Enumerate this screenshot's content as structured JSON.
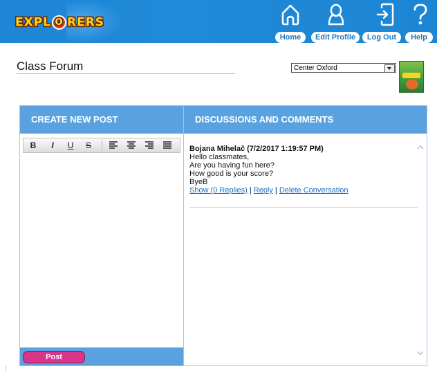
{
  "header": {
    "logo_letters": [
      "EXPL",
      "O",
      "RERS"
    ],
    "nav": [
      {
        "label": "Home",
        "icon": "home-icon"
      },
      {
        "label": "Edit Profile",
        "icon": "user-icon"
      },
      {
        "label": "Log Out",
        "icon": "logout-icon"
      },
      {
        "label": "Help",
        "icon": "help-icon"
      }
    ]
  },
  "page": {
    "title": "Class Forum",
    "class_select": {
      "selected": "Center Oxford"
    },
    "book_cover_icon": "book-cover-icon"
  },
  "create_post": {
    "heading": "CREATE NEW POST",
    "toolbar": [
      {
        "glyph": "B",
        "icon": "bold-icon"
      },
      {
        "glyph": "I",
        "icon": "italic-icon"
      },
      {
        "glyph": "U",
        "icon": "underline-icon"
      },
      {
        "glyph": "S",
        "icon": "strikethrough-icon"
      },
      {
        "glyph": "",
        "icon": "align-left-icon"
      },
      {
        "glyph": "",
        "icon": "align-center-icon"
      },
      {
        "glyph": "",
        "icon": "align-right-icon"
      },
      {
        "glyph": "",
        "icon": "justify-icon"
      }
    ],
    "post_label": "Post"
  },
  "discussions": {
    "heading": "DISCUSSIONS AND COMMENTS",
    "posts": [
      {
        "author_line": "Bojana Mihelač (7/2/2017 1:19:57 PM)",
        "lines": [
          "Hello classmates,",
          "Are you having fun here?",
          "How good is your score?",
          "ByeB"
        ],
        "show_replies": "Show (0 Replies)",
        "separator": " | ",
        "reply": "Reply",
        "delete": "Delete Conversation"
      }
    ]
  },
  "colors": {
    "header_blue": "#1e86d6",
    "column_header_blue": "#5aa2df",
    "post_button_pink": "#d9358a",
    "link_blue": "#1b6fc2"
  }
}
